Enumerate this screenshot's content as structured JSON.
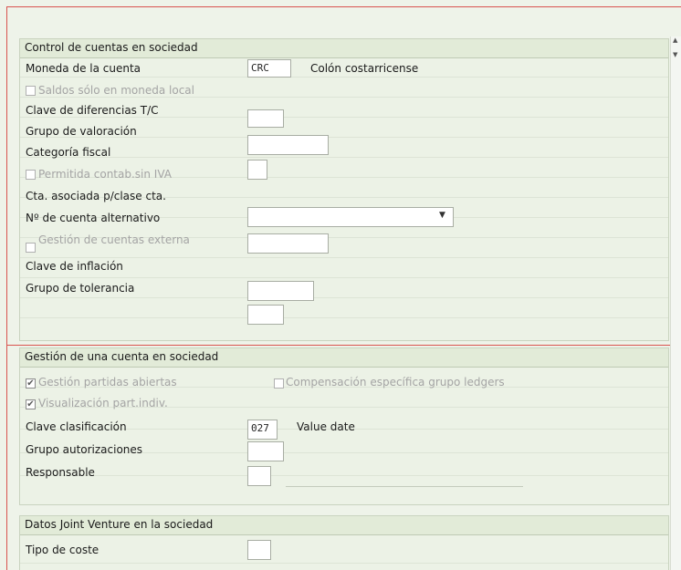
{
  "section1": {
    "title": "Control de cuentas en sociedad",
    "currency_label": "Moneda de la cuenta",
    "currency_value": "CRC",
    "currency_desc": "Colón costarricense",
    "local_currency_only_label": "Saldos sólo en moneda local",
    "exchange_diff_label": "Clave de diferencias T/C",
    "valuation_group_label": "Grupo de valoración",
    "tax_category_label": "Categoría fiscal",
    "posting_without_tax_label": "Permitida contab.sin IVA",
    "recon_account_label": "Cta. asociada p/clase cta.",
    "alt_account_label": "Nº de cuenta alternativo",
    "external_mgmt_label": "Gestión de cuentas externa",
    "inflation_key_label": "Clave de inflación",
    "tolerance_group_label": "Grupo de tolerancia"
  },
  "section2": {
    "title": "Gestión de una cuenta en sociedad",
    "open_items_label": "Gestión partidas abiertas",
    "ledger_clearing_label": "Compensación específica grupo ledgers",
    "line_items_label": "Visualización part.indiv.",
    "sort_key_label": "Clave clasificación",
    "sort_key_value": "027",
    "sort_key_desc": "Value date",
    "auth_group_label": "Grupo autorizaciones",
    "responsible_label": "Responsable"
  },
  "section3": {
    "title": "Datos Joint Venture en la sociedad",
    "cost_type_label": "Tipo de coste"
  },
  "icons": {
    "scroll_up": "▲",
    "scroll_down": "▼",
    "dropdown": "▼",
    "check": "✔"
  }
}
